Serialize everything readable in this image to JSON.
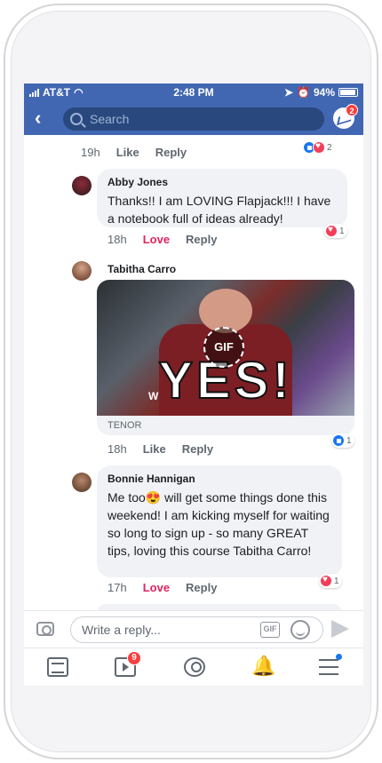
{
  "status": {
    "carrier": "AT&T",
    "time": "2:48 PM",
    "battery": "94%"
  },
  "nav": {
    "search_placeholder": "Search",
    "messenger_badge": "2"
  },
  "comments": {
    "top": {
      "time": "19h",
      "like_label": "Like",
      "reply_label": "Reply",
      "reaction_count": "2"
    },
    "abby": {
      "author": "Abby Jones",
      "text": "Thanks!! I am LOVING Flapjack!!! I have a notebook full of ideas already!",
      "time": "18h",
      "like_label": "Love",
      "reply_label": "Reply",
      "reaction_count": "1"
    },
    "tabitha": {
      "author": "Tabitha Carro",
      "gif_text": "YES!",
      "gif_badge": "GIF",
      "gif_source": "TENOR",
      "time": "18h",
      "like_label": "Like",
      "reply_label": "Reply",
      "reaction_count": "1"
    },
    "bonnie": {
      "author": "Bonnie Hannigan",
      "text": "Me too😍 will get some things done this weekend!  I am kicking myself for waiting so long to sign up - so many GREAT tips, loving this course Tabitha Carro!",
      "time": "17h",
      "like_label": "Love",
      "reply_label": "Reply",
      "reaction_count": "1"
    }
  },
  "reply_bar": {
    "placeholder": "Write a reply...",
    "gif_label": "GIF"
  },
  "tabbar": {
    "video_badge": "9"
  },
  "colors": {
    "brand": "#4267b2",
    "love": "#e0245e",
    "badge": "#fa3e3e",
    "notification": "#f2a600"
  }
}
